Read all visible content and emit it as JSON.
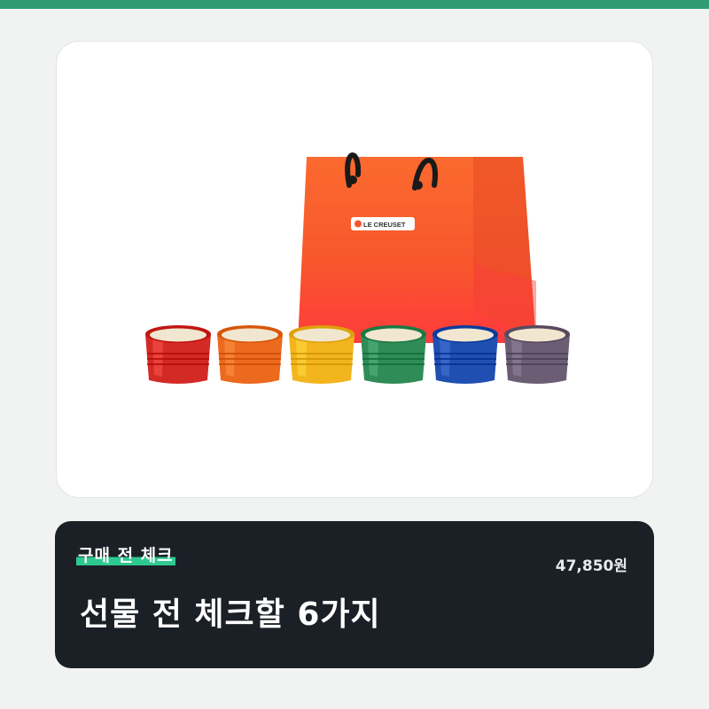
{
  "product": {
    "brand": "LE CREUSET",
    "bowl_colors": [
      "#d42a26",
      "#ec6a1e",
      "#f2b51d",
      "#2f8c57",
      "#1f4fb0",
      "#6b5e74"
    ],
    "bag_color": "#f7552e"
  },
  "info": {
    "tag": "구매 전 체크",
    "price": "47,850원",
    "title": "선물 전 체크할 6가지"
  },
  "colors": {
    "accent": "#2e9b72",
    "highlight": "#2ec98f",
    "panel": "#1b2027"
  }
}
